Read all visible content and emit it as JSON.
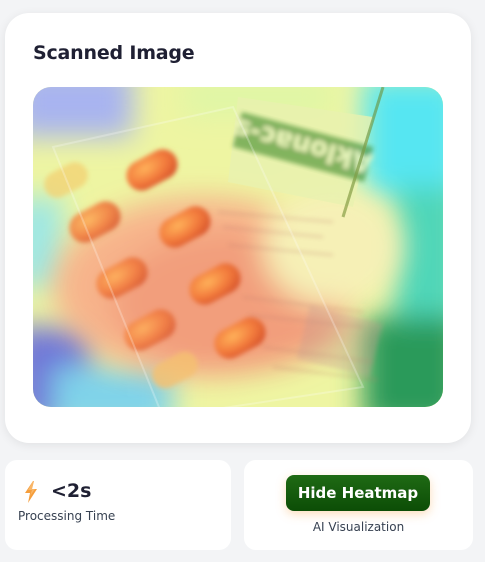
{
  "scanned_card": {
    "title": "Scanned Image",
    "image_label": "Aklonac-s"
  },
  "stats": {
    "processing_value": "<2s",
    "processing_label": "Processing Time",
    "icon": "bolt-icon"
  },
  "actions": {
    "heatmap_button": "Hide Heatmap",
    "heatmap_caption": "AI Visualization"
  },
  "colors": {
    "title_text": "#1f2033",
    "button_green": "#0c4d06",
    "bolt_orange": "#f59e3c",
    "background": "#f3f4f6"
  }
}
